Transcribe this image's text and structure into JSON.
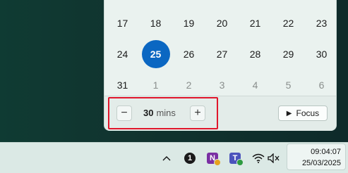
{
  "calendar": {
    "rows": [
      [
        {
          "n": "17"
        },
        {
          "n": "18"
        },
        {
          "n": "19"
        },
        {
          "n": "20"
        },
        {
          "n": "21"
        },
        {
          "n": "22"
        },
        {
          "n": "23"
        }
      ],
      [
        {
          "n": "24"
        },
        {
          "n": "25",
          "today": true
        },
        {
          "n": "26"
        },
        {
          "n": "27"
        },
        {
          "n": "28"
        },
        {
          "n": "29"
        },
        {
          "n": "30"
        }
      ],
      [
        {
          "n": "31"
        },
        {
          "n": "1",
          "other": true
        },
        {
          "n": "2",
          "other": true
        },
        {
          "n": "3",
          "other": true
        },
        {
          "n": "4",
          "other": true
        },
        {
          "n": "5",
          "other": true
        },
        {
          "n": "6",
          "other": true
        }
      ]
    ],
    "accent_color": "#0b67c2"
  },
  "focus": {
    "minus_label": "−",
    "plus_label": "+",
    "minutes": "30",
    "unit": "mins",
    "button_label": "Focus",
    "play_glyph": "▶",
    "highlight_color": "#e0162b"
  },
  "taskbar": {
    "chevron": "^",
    "onepassword_glyph": "1",
    "onenote_glyph": "N",
    "teams_glyph": "T",
    "time": "09:04:07",
    "date": "25/03/2025"
  },
  "icons": [
    "chevron-up-icon",
    "onepassword-icon",
    "onenote-icon",
    "teams-icon",
    "wifi-icon",
    "speaker-muted-icon",
    "play-icon"
  ]
}
